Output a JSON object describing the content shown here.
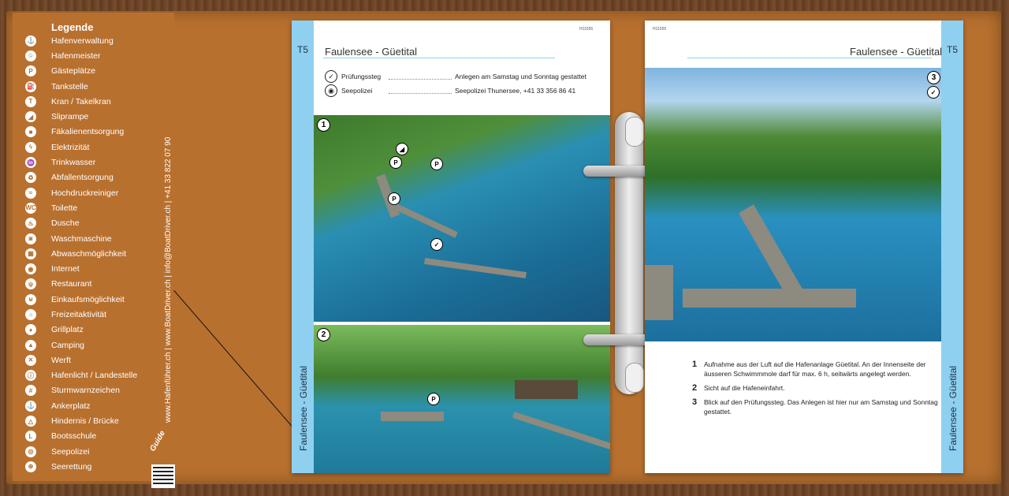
{
  "legend": {
    "title": "Legende",
    "items": [
      {
        "icon": "harbor-admin-icon",
        "glyph": "⚓",
        "label": "Hafenverwaltung"
      },
      {
        "icon": "harbor-master-icon",
        "glyph": "☺",
        "label": "Hafenmeister"
      },
      {
        "icon": "guest-berth-icon",
        "glyph": "P",
        "label": "Gästeplätze"
      },
      {
        "icon": "fuel-icon",
        "glyph": "⛽",
        "label": "Tankstelle"
      },
      {
        "icon": "crane-icon",
        "glyph": "T",
        "label": "Kran / Takelkran"
      },
      {
        "icon": "slipway-icon",
        "glyph": "◢",
        "label": "Sliprampe"
      },
      {
        "icon": "waste-water-icon",
        "glyph": "■",
        "label": "Fäkalienentsorgung"
      },
      {
        "icon": "electricity-icon",
        "glyph": "ϟ",
        "label": "Elektrizität"
      },
      {
        "icon": "water-icon",
        "glyph": "♒",
        "label": "Trinkwasser"
      },
      {
        "icon": "waste-icon",
        "glyph": "♻",
        "label": "Abfallentsorgung"
      },
      {
        "icon": "pressure-washer-icon",
        "glyph": "≈",
        "label": "Hochdruckreiniger"
      },
      {
        "icon": "toilet-icon",
        "glyph": "WC",
        "label": "Toilette"
      },
      {
        "icon": "shower-icon",
        "glyph": "♨",
        "label": "Dusche"
      },
      {
        "icon": "washing-machine-icon",
        "glyph": "◙",
        "label": "Waschmaschine"
      },
      {
        "icon": "dishwashing-icon",
        "glyph": "▦",
        "label": "Abwaschmöglichkeit"
      },
      {
        "icon": "internet-icon",
        "glyph": "◉",
        "label": "Internet"
      },
      {
        "icon": "restaurant-icon",
        "glyph": "ψ",
        "label": "Restaurant"
      },
      {
        "icon": "shopping-icon",
        "glyph": "⊌",
        "label": "Einkaufsmöglichkeit"
      },
      {
        "icon": "leisure-icon",
        "glyph": "☼",
        "label": "Freizeitaktivität"
      },
      {
        "icon": "grill-icon",
        "glyph": "♦",
        "label": "Grillplatz"
      },
      {
        "icon": "camping-icon",
        "glyph": "▲",
        "label": "Camping"
      },
      {
        "icon": "shipyard-icon",
        "glyph": "✕",
        "label": "Werft"
      },
      {
        "icon": "harbor-light-icon",
        "glyph": "ⓘ",
        "label": "Hafenlicht / Landestelle"
      },
      {
        "icon": "storm-warning-icon",
        "glyph": "#",
        "label": "Sturmwarnzeichen"
      },
      {
        "icon": "anchorage-icon",
        "glyph": "⚓",
        "label": "Ankerplatz"
      },
      {
        "icon": "obstacle-icon",
        "glyph": "△",
        "label": "Hindernis / Brücke"
      },
      {
        "icon": "boat-school-icon",
        "glyph": "L",
        "label": "Bootsschule"
      },
      {
        "icon": "lake-police-icon",
        "glyph": "◎",
        "label": "Seepolizei"
      },
      {
        "icon": "rescue-icon",
        "glyph": "⊕",
        "label": "Seerettung"
      }
    ],
    "contact_text": "www.Hafenführer.ch | www.BoatDriver.ch | info@BoatDriver.ch | +41 33 822 07 90",
    "logo_text": "Guide"
  },
  "left_page": {
    "code": "H11555",
    "section_tag": "T5",
    "title": "Faulensee - Güetital",
    "vertical_title": "Faulensee - Güetital",
    "info": [
      {
        "icon": "check-icon",
        "glyph": "✓",
        "label": "Prüfungssteg",
        "value": "Anlegen am Samstag und Sonntag gestattet"
      },
      {
        "icon": "eye-icon",
        "glyph": "◉",
        "label": "Seepolizei",
        "value": "Seepolizei Thunersee,  +41 33 356 86 41"
      }
    ],
    "photo1_num": "1",
    "photo2_num": "2",
    "markers": [
      "P",
      "P",
      "P",
      "P"
    ]
  },
  "right_page": {
    "code": "H11555",
    "section_tag": "T5",
    "title": "Faulensee - Güetital",
    "vertical_title": "Faulensee - Güetital",
    "photo3_num": "3",
    "captions": [
      {
        "n": "1",
        "text": "Aufnahme aus der Luft auf die Hafenanlage Güetital. An der Innenseite der äusseren Schwimmmole darf für max. 6 h, seitwärts angelegt werden."
      },
      {
        "n": "2",
        "text": "Sicht auf die Hafeneinfahrt."
      },
      {
        "n": "3",
        "text": "Blick auf den Prüfungssteg. Das Anlegen ist hier nur am Samstag und Sonntag gestattet."
      }
    ]
  }
}
